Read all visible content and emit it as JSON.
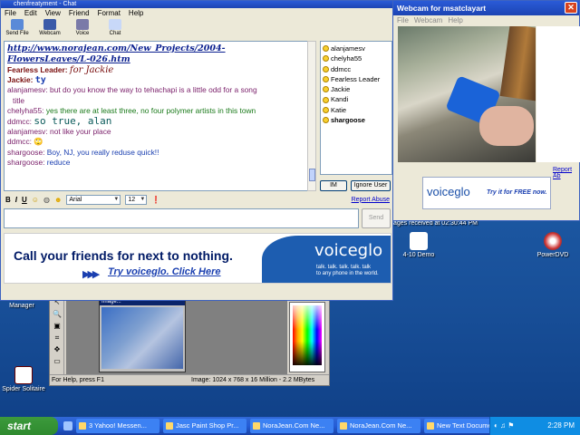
{
  "chat_window": {
    "title": "chenfreatyment - Chat",
    "menu": [
      "File",
      "Edit",
      "View",
      "Friend",
      "Format",
      "Help"
    ],
    "toolbar": [
      {
        "label": "Send File",
        "icon": "send-file-icon"
      },
      {
        "label": "Webcam",
        "icon": "webcam-icon"
      },
      {
        "label": "Voice",
        "icon": "voice-icon"
      },
      {
        "label": "Chat",
        "icon": "chat-icon"
      }
    ],
    "messages": [
      {
        "nick": "",
        "text": "http://www.norajean.com/New_Projects/2004-",
        "style": "link"
      },
      {
        "nick": "",
        "text": "FlowersLeaves/L-026.htm",
        "style": "link"
      },
      {
        "nick": "Fearless Leader:",
        "text": "for Jackie",
        "style": "fancy",
        "color": "#7a1010"
      },
      {
        "nick": "Jackie:",
        "text": "ty",
        "style": "mono",
        "color": "#7a1010"
      },
      {
        "nick": "alanjamesv:",
        "text": "but do you know the way to tehachapi is a little odd for a song",
        "style": "plain",
        "color": "#7a1f6a"
      },
      {
        "nick": "",
        "text": "title",
        "style": "plain",
        "color": "#7a1f6a"
      },
      {
        "nick": "chelyha55:",
        "text": "yes there are at least three, no four polymer artists in this town",
        "style": "plain",
        "color": "#1a7a1a"
      },
      {
        "nick": "ddmcc:",
        "text": "so true, alan",
        "style": "big",
        "color": "#0a5a5a"
      },
      {
        "nick": "alanjamesv:",
        "text": "not like your place",
        "style": "plain",
        "color": "#7a1f6a"
      },
      {
        "nick": "ddmcc:",
        "text": "🙄",
        "style": "plain",
        "color": "#0a5a5a"
      },
      {
        "nick": "shargoose:",
        "text": "Boy, NJ, you really reduse quick!!",
        "style": "plain",
        "color": "#1a3fb0"
      },
      {
        "nick": "shargoose:",
        "text": "reduce",
        "style": "plain",
        "color": "#1a3fb0"
      }
    ],
    "users": [
      "alanjamesv",
      "chelyha55",
      "ddmcc",
      "Fearless Leader",
      "Jackie",
      "Kandi",
      "Katie",
      "shargoose"
    ],
    "buttons": {
      "im": "IM",
      "ignore": "Ignore User",
      "report": "Report Abuse",
      "send": "Send"
    },
    "format": {
      "bold": "B",
      "italic": "I",
      "underline": "U",
      "font": "Arial",
      "size": "12"
    },
    "banner": {
      "headline": "Call your friends for next to nothing.",
      "cta": "Try voiceglo. Click Here",
      "logo": "voiceglo",
      "tagline1": "talk. talk. talk. talk. talk",
      "tagline2": "to any phone in the world."
    }
  },
  "webcam_window": {
    "title": "Webcam for msatclayart",
    "menu": [
      "File",
      "Webcam",
      "Help"
    ],
    "report": "Report Ab",
    "ad_logo": "voiceglo",
    "ad_text": "Try it for FREE now."
  },
  "paint_app": {
    "status_left": "For Help, press F1",
    "status_image": "Image:  1024 x 768 x 16 Million - 2.2 MBytes"
  },
  "desktop": {
    "icons": [
      {
        "label": "4-10 Demo",
        "icon": "document-icon"
      },
      {
        "label": "PowerDVD",
        "icon": "powerdvd-icon"
      },
      {
        "label": "Spider Solitaire",
        "icon": "spider-solitaire-icon"
      },
      {
        "label": "Manager",
        "icon": "manager-icon"
      }
    ],
    "partial_text": "ages received at 02:30:44 PM"
  },
  "taskbar": {
    "start": "start",
    "tasks": [
      "3 Yahoo! Messen...",
      "Jasc Paint Shop Pr...",
      "NoraJean.Com Ne...",
      "NoraJean.Com Ne...",
      "New Text Documen..."
    ],
    "clock": "2:28 PM"
  }
}
